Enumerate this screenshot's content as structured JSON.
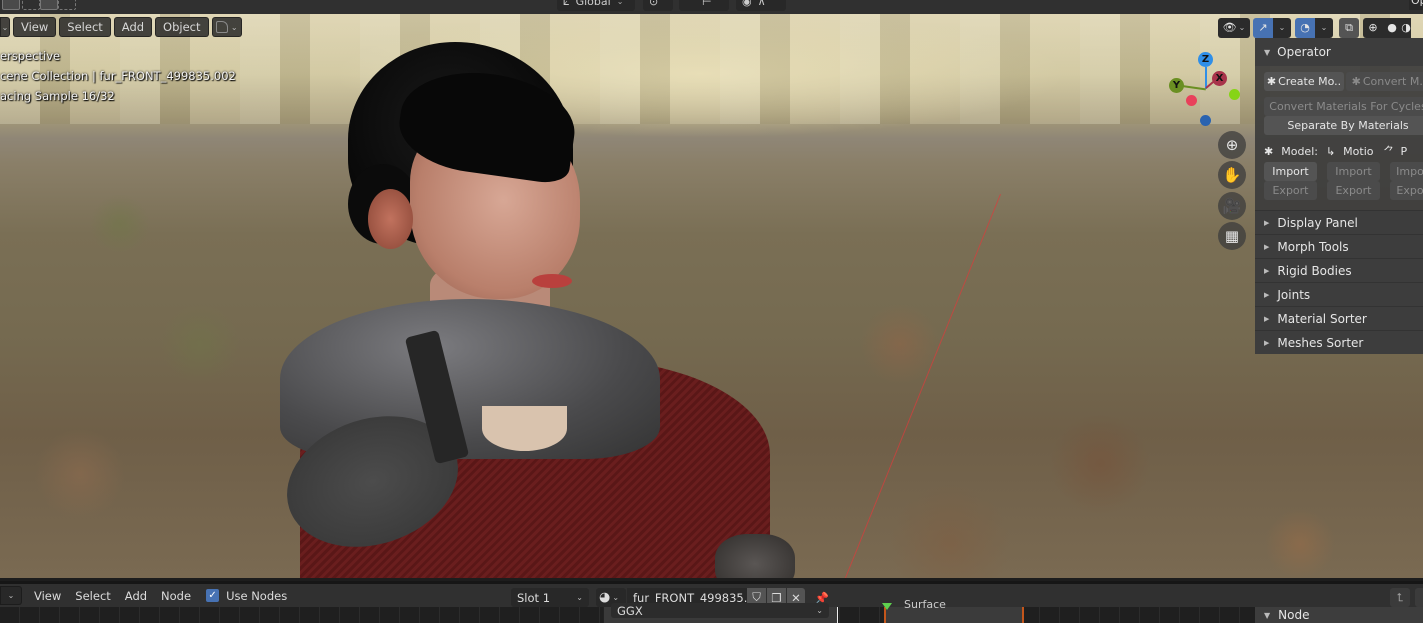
{
  "header": {
    "orientation_label": "Global",
    "operator_tab_label": "Op"
  },
  "viewport": {
    "menu": {
      "view": "View",
      "select": "Select",
      "add": "Add",
      "object": "Object"
    },
    "overlay": {
      "view_mode": "erspective",
      "collection": "cene Collection | fur_FRONT_499835.002",
      "render_status": "acing Sample 16/32"
    },
    "gizmo": {
      "x_label": "X",
      "y_label": "Y",
      "z_label": "Z",
      "colors": {
        "x": "#a8334a",
        "y": "#6a8f22",
        "z": "#2f8fe8",
        "neg_x": "#e8405a",
        "neg_y": "#86d416",
        "neg_z": "#2a63b0"
      }
    },
    "nav_buttons": [
      "zoom-icon",
      "pan-hand-icon",
      "camera-icon",
      "ortho-grid-icon"
    ],
    "accent_color": "#4772b3"
  },
  "npanel": {
    "operator_header": "Operator",
    "create_model_button": "Create Mo..",
    "convert_model_button": "Convert M..",
    "convert_materials_button": "Convert Materials For Cycles",
    "separate_materials_button": "Separate By Materials",
    "model_label": "Model:",
    "motion_label": "Motio",
    "pose_label": "P",
    "import_buttons": [
      "Import",
      "Import",
      "Impo"
    ],
    "export_buttons": [
      "Export",
      "Export",
      "Expo"
    ],
    "sections": [
      "Display Panel",
      "Morph Tools",
      "Rigid Bodies",
      "Joints",
      "Material Sorter",
      "Meshes Sorter"
    ]
  },
  "node_editor": {
    "menu": {
      "view": "View",
      "select": "Select",
      "add": "Add",
      "node": "Node"
    },
    "use_nodes_label": "Use Nodes",
    "use_nodes_checked": true,
    "slot_label": "Slot 1",
    "material_name": "fur_FRONT_499835..",
    "distribution_value": "GGX",
    "output_socket_label": "Surface",
    "sidebar_header": "Node"
  }
}
